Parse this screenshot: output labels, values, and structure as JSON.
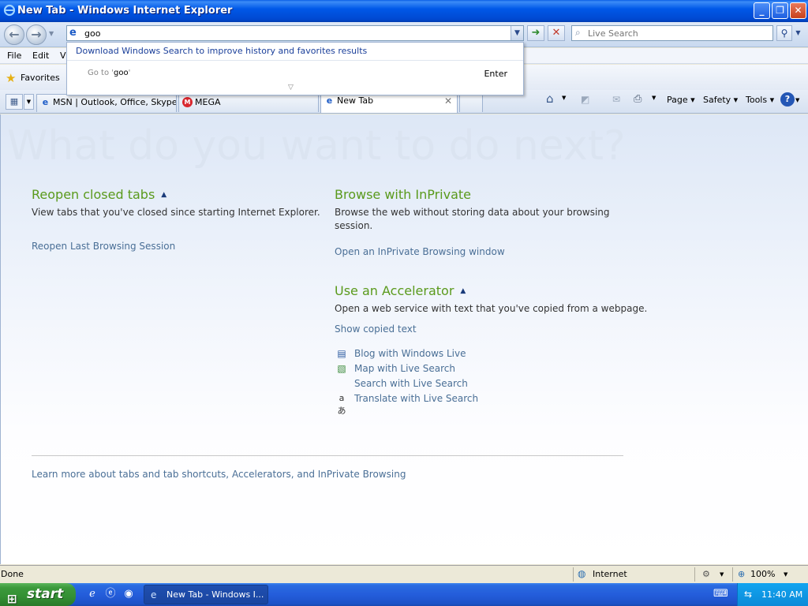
{
  "window": {
    "title": "New Tab - Windows Internet Explorer",
    "minimize": "_",
    "maximize": "❐",
    "close": "✕"
  },
  "address_bar": {
    "value": "goo",
    "search_placeholder": "Live Search"
  },
  "autocomplete": {
    "promo": "Download Windows Search to improve history and favorites results",
    "goto_prefix": "Go to '",
    "goto_value": "goo",
    "goto_suffix": "'",
    "enter_label": "Enter"
  },
  "menu": {
    "items": [
      "File",
      "Edit",
      "Vi"
    ]
  },
  "favorites": {
    "label": "Favorites"
  },
  "tabs": [
    {
      "label": "MSN | Outlook, Office, Skype..."
    },
    {
      "label": "MEGA"
    },
    {
      "label": "New Tab"
    }
  ],
  "command_bar": {
    "page": "Page ▾",
    "safety": "Safety ▾",
    "tools": "Tools ▾"
  },
  "content": {
    "headline": "What do you want to do next?",
    "reopen": {
      "heading": "Reopen closed tabs",
      "description": "View tabs that you've closed since starting Internet Explorer.",
      "link": "Reopen Last Browsing Session"
    },
    "inprivate": {
      "heading": "Browse with InPrivate",
      "description_line1": "Browse the web without storing data about your browsing",
      "description_line2": "session.",
      "link": "Open an InPrivate Browsing window"
    },
    "accelerator": {
      "heading": "Use an Accelerator",
      "description": "Open a web service with text that you've copied from a webpage.",
      "show_copied": "Show copied text",
      "items": [
        "Blog with Windows Live",
        "Map with Live Search",
        "Search with Live Search",
        "Translate with Live Search"
      ]
    },
    "learn_more": "Learn more about tabs and tab shortcuts, Accelerators, and InPrivate Browsing"
  },
  "status_bar": {
    "status": "Done",
    "zone": "Internet",
    "zoom": "100%"
  },
  "taskbar": {
    "start": "start",
    "task_item": "New Tab - Windows I...",
    "clock": "11:40 AM"
  }
}
